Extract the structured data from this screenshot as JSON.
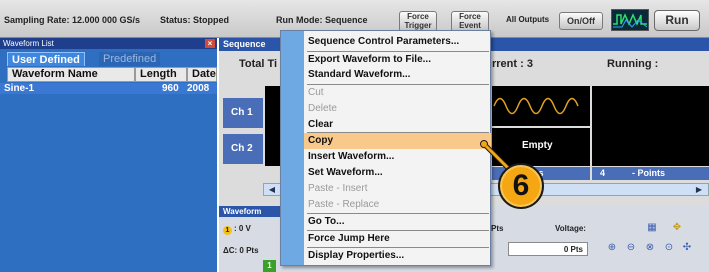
{
  "topbar": {
    "sampling_rate": "Sampling Rate: 12.000 000 GS/s",
    "status": "Status: Stopped",
    "run_mode": "Run Mode: Sequence",
    "force_trigger": "Force\nTrigger",
    "force_event": "Force\nEvent",
    "all_outputs": "All Outputs",
    "on_off": "On/Off",
    "run": "Run"
  },
  "waveform_list": {
    "title": "Waveform List",
    "tabs": [
      "User Defined",
      "Predefined"
    ],
    "columns": [
      "Waveform Name",
      "Length",
      "Date"
    ],
    "rows": [
      {
        "name": "Sine-1",
        "length": "960",
        "date": "2008"
      }
    ]
  },
  "sequence": {
    "title": "Sequence",
    "total_label": "Total Ti",
    "current": "rrent : 3",
    "running": "Running :",
    "channels": [
      "Ch 1",
      "Ch 2"
    ],
    "empty": "Empty",
    "points_col3": "Points",
    "points_col4_num": "4",
    "points_col4": "- Points"
  },
  "waveform_panel": {
    "title": "Waveform",
    "marker_value": ": 0 V",
    "marker_number": "1",
    "delta": "ΔC: 0 Pts",
    "pts": "Pts",
    "voltage": "Voltage:",
    "zero_pts": "0 Pts",
    "page_number": "1"
  },
  "context_menu": {
    "items": [
      {
        "label": "Sequence Control Parameters...",
        "enabled": true
      },
      {
        "label": "Export Waveform to File...",
        "enabled": true
      },
      {
        "label": "Standard Waveform...",
        "enabled": true
      },
      {
        "label": "Cut",
        "enabled": false
      },
      {
        "label": "Delete",
        "enabled": false
      },
      {
        "label": "Clear",
        "enabled": true
      },
      {
        "label": "Copy",
        "enabled": true,
        "highlighted": true
      },
      {
        "label": "Insert Waveform...",
        "enabled": true
      },
      {
        "label": "Set Waveform...",
        "enabled": true
      },
      {
        "label": "Paste - Insert",
        "enabled": false
      },
      {
        "label": "Paste - Replace",
        "enabled": false
      },
      {
        "label": "Go To...",
        "enabled": true
      },
      {
        "label": "Force Jump Here",
        "enabled": true
      },
      {
        "label": "Display Properties...",
        "enabled": true
      }
    ]
  },
  "callout": {
    "number": "6"
  },
  "colors": {
    "menu_highlight": "#f8c98a",
    "menu_strip": "#6fa9e3",
    "panel_blue": "#2f6fc2",
    "callout": "#f4a712",
    "sine_wave": "#e0a020"
  },
  "icons": [
    "close-icon",
    "waveform-output-icon",
    "scroll-left-icon",
    "scroll-right-icon",
    "marker-1-icon",
    "zoom-in-icon",
    "zoom-out-icon",
    "fit-icon",
    "cursor-move-icon",
    "grid-icon"
  ]
}
